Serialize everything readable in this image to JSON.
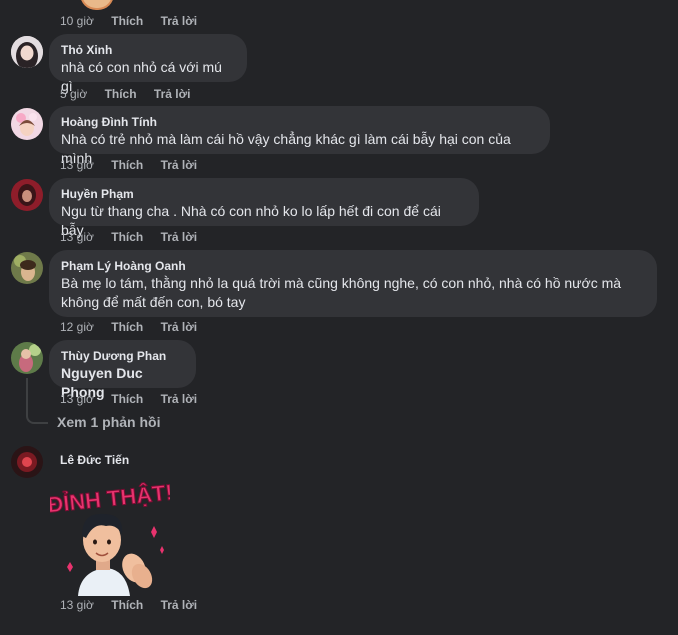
{
  "top_partial": {
    "time": "10 giờ",
    "like": "Thích",
    "reply": "Trả lời"
  },
  "comments": [
    {
      "author": "Thỏ Xinh",
      "text": "nhà có con nhỏ cá với mú gì",
      "time": "5 giờ",
      "like": "Thích",
      "reply": "Trả lời"
    },
    {
      "author": "Hoàng Đình Tính",
      "text": "Nhà có trẻ nhỏ mà làm cái hồ vậy chẳng khác gì làm cái bẫy hại con của mình",
      "time": "13 giờ",
      "like": "Thích",
      "reply": "Trả lời"
    },
    {
      "author": "Huyền Phạm",
      "text": "Ngu từ thang cha . Nhà có con nhỏ ko lo lấp hết đi con để cái bẫy",
      "time": "13 giờ",
      "like": "Thích",
      "reply": "Trả lời"
    },
    {
      "author": "Phạm Lý Hoàng Oanh",
      "text_line1": "Bà mẹ lo tám, thằng nhỏ la quá trời mà cũng không nghe, có con nhỏ, nhà có hồ nước mà",
      "text_line2": "không để mất đến con, bó tay",
      "time": "12 giờ",
      "like": "Thích",
      "reply": "Trả lời"
    },
    {
      "author": "Thùy Dương Phan",
      "text": "Nguyen Duc Phong",
      "time": "13 giờ",
      "like": "Thích",
      "reply": "Trả lời",
      "view_replies": "Xem 1 phản hồi"
    },
    {
      "author": "Lê Đức Tiến",
      "sticker_text": "ĐỈNH THẬT!",
      "time": "13 giờ",
      "like": "Thích",
      "reply": "Trả lời"
    }
  ],
  "colors": {
    "background": "#232427",
    "bubble": "#333438",
    "text": "#e4e6eb",
    "meta": "#b0b3b8",
    "sticker_pink": "#e8336e"
  }
}
